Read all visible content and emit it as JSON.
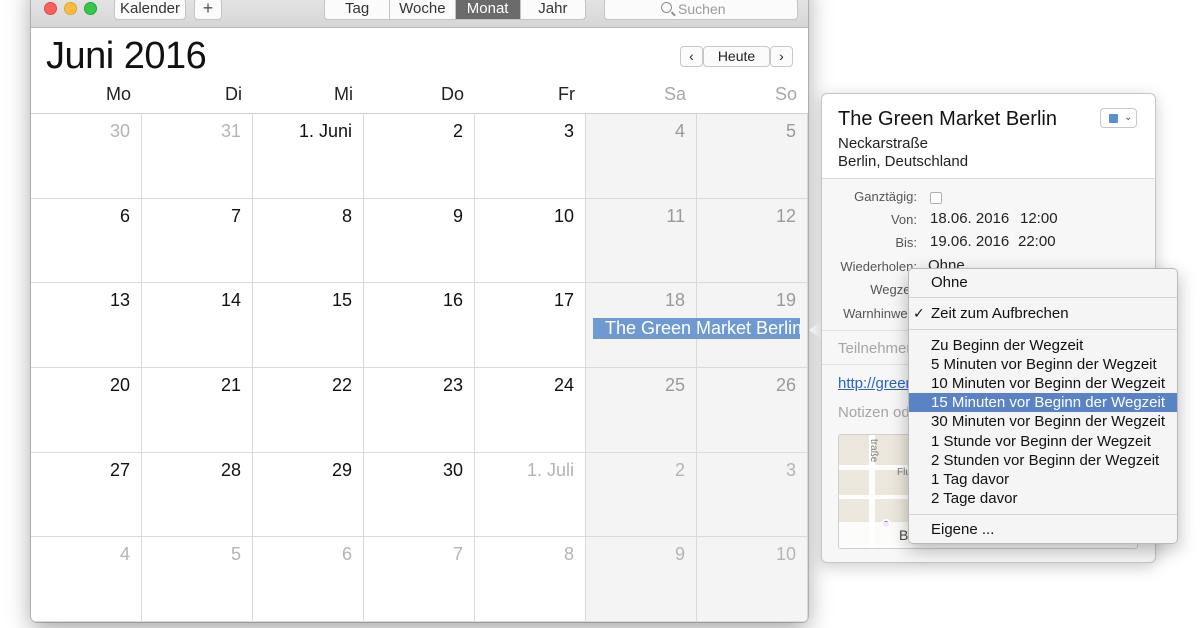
{
  "toolbar": {
    "calendars_label": "Kalender",
    "add_label": "+",
    "views": [
      "Tag",
      "Woche",
      "Monat",
      "Jahr"
    ],
    "active_view": "Monat",
    "search_placeholder": "Suchen"
  },
  "calendar": {
    "month_title": "Juni 2016",
    "prev_label": "‹",
    "today_label": "Heute",
    "next_label": "›",
    "weekdays": [
      "Mo",
      "Di",
      "Mi",
      "Do",
      "Fr",
      "Sa",
      "So"
    ],
    "weeks": [
      [
        "30",
        "31",
        "1. Juni",
        "2",
        "3",
        "4",
        "5"
      ],
      [
        "6",
        "7",
        "8",
        "9",
        "10",
        "11",
        "12"
      ],
      [
        "13",
        "14",
        "15",
        "16",
        "17",
        "18",
        "19"
      ],
      [
        "20",
        "21",
        "22",
        "23",
        "24",
        "25",
        "26"
      ],
      [
        "27",
        "28",
        "29",
        "30",
        "1. Juli",
        "2",
        "3"
      ],
      [
        "4",
        "5",
        "6",
        "7",
        "8",
        "9",
        "10"
      ]
    ],
    "event_label": "The Green Market Berlin"
  },
  "event_popover": {
    "title": "The Green Market Berlin",
    "address_line1": "Neckarstraße",
    "address_line2": "Berlin, Deutschland",
    "calendar_color": "#5b8fd4",
    "allday_label": "Ganztägig:",
    "from_label": "Von:",
    "from_date": "18.06. 2016",
    "from_time": "12:00",
    "to_label": "Bis:",
    "to_date": "19.06. 2016",
    "to_time": "22:00",
    "repeat_label": "Wiederholen:",
    "repeat_value": "Ohne",
    "travel_label": "Wegzeit",
    "alert_label": "Warnhinweis",
    "invitees_placeholder": "Teilnehmer",
    "url_text": "http://greer",
    "notes_placeholder": "Notizen od",
    "map_street_1": "traße",
    "map_street_2": "Flu",
    "map_caption": "B"
  },
  "alert_menu": {
    "items_top": [
      "Ohne"
    ],
    "checked_item": "Zeit zum Aufbrechen",
    "items_mid": [
      "Zu Beginn der Wegzeit",
      "5 Minuten vor Beginn der Wegzeit",
      "10 Minuten vor Beginn der Wegzeit",
      "15 Minuten vor Beginn der Wegzeit",
      "30 Minuten vor Beginn der Wegzeit",
      "1 Stunde vor Beginn der Wegzeit",
      "2 Stunden vor Beginn der Wegzeit",
      "1 Tag davor",
      "2 Tage davor"
    ],
    "highlighted_index": 3,
    "custom_label": "Eigene ..."
  },
  "colors": {
    "event_blue": "#6e99d1",
    "menu_highlight": "#5a83c6",
    "link_blue": "#2a62c9"
  }
}
